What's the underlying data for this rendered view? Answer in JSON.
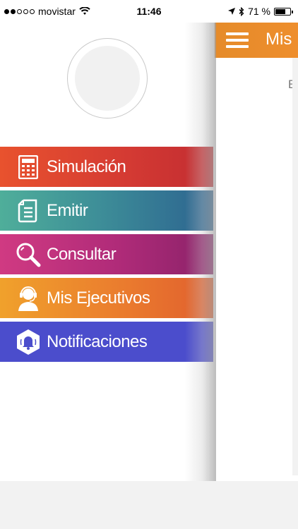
{
  "status_bar": {
    "carrier": "movistar",
    "time": "11:46",
    "battery_percent": "71 %",
    "battery_level": 0.71
  },
  "main": {
    "title": "Mis",
    "body_text": "E"
  },
  "drawer": {
    "menu": [
      {
        "label": "Simulación",
        "icon": "calculator-icon"
      },
      {
        "label": "Emitir",
        "icon": "document-icon"
      },
      {
        "label": "Consultar",
        "icon": "magnifier-icon"
      },
      {
        "label": "Mis Ejecutivos",
        "icon": "agent-headset-icon"
      },
      {
        "label": "Notificaciones",
        "icon": "bell-hexagon-icon"
      }
    ]
  },
  "colors": {
    "header_orange": "#e58b2a",
    "simulacion": "#d43a33",
    "emitir": "#3e8f98",
    "consultar": "#b02b79",
    "ejecutivos": "#ea7a2e",
    "notificaciones": "#4b4dcc"
  }
}
